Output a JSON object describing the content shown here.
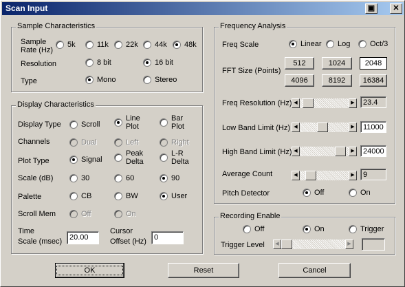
{
  "window": {
    "title": "Scan Input",
    "copy_icon": "▣",
    "close_icon": "✕"
  },
  "sample": {
    "group_label": "Sample Characteristics",
    "sample_rate": {
      "label1": "Sample",
      "label2": "Rate (Hz)",
      "options": [
        "5k",
        "11k",
        "22k",
        "44k",
        "48k"
      ],
      "selected": "48k"
    },
    "resolution": {
      "label": "Resolution",
      "options": [
        "8 bit",
        "16 bit"
      ],
      "selected": "16 bit"
    },
    "type": {
      "label": "Type",
      "options": [
        "Mono",
        "Stereo"
      ],
      "selected": "Mono"
    }
  },
  "display": {
    "group_label": "Display Characteristics",
    "display_type": {
      "label": "Display Type",
      "scroll": "Scroll",
      "line1": "Line",
      "line2": "Plot",
      "bar1": "Bar",
      "bar2": "Plot",
      "selected": "Line Plot"
    },
    "channels": {
      "label": "Channels",
      "options": [
        "Dual",
        "Left",
        "Right"
      ]
    },
    "plot_type": {
      "label": "Plot Type",
      "signal": "Signal",
      "peak1": "Peak",
      "peak2": "Delta",
      "lr1": "L-R",
      "lr2": "Delta",
      "selected": "Signal"
    },
    "scale": {
      "label": "Scale (dB)",
      "options": [
        "30",
        "60",
        "90"
      ],
      "selected": "90"
    },
    "palette": {
      "label": "Palette",
      "options": [
        "CB",
        "BW",
        "User"
      ],
      "selected": "User"
    },
    "scroll_mem": {
      "label": "Scroll Mem",
      "options": [
        "Off",
        "On"
      ]
    },
    "time_scale": {
      "label1": "Time",
      "label2": "Scale (msec)",
      "value": "20.00"
    },
    "cursor_offset": {
      "label1": "Cursor",
      "label2": "Offset (Hz)",
      "value": "0"
    }
  },
  "frequency": {
    "group_label": "Frequency Analysis",
    "freq_scale": {
      "label": "Freq Scale",
      "options": [
        "Linear",
        "Log",
        "Oct/3"
      ],
      "selected": "Linear"
    },
    "fft_size": {
      "label": "FFT Size (Points)",
      "options": [
        "512",
        "1024",
        "2048",
        "4096",
        "8192",
        "16384"
      ],
      "selected": "2048"
    },
    "freq_resolution": {
      "label": "Freq Resolution (Hz)",
      "value": "23.4",
      "position": 0.08
    },
    "low_band": {
      "label": "Low Band Limit (Hz)",
      "value": "11000",
      "position": 0.45
    },
    "high_band": {
      "label": "High Band Limit (Hz)",
      "value": "24000",
      "position": 0.93
    },
    "average_count": {
      "label": "Average Count",
      "value": "9",
      "position": 0.15
    },
    "pitch_detector": {
      "label": "Pitch Detector",
      "options": [
        "Off",
        "On"
      ],
      "selected": "Off"
    }
  },
  "recording": {
    "group_label": "Recording Enable",
    "options": [
      "Off",
      "On",
      "Trigger"
    ],
    "selected": "On",
    "trigger_level": {
      "label": "Trigger Level",
      "value": "",
      "position": 0.0
    }
  },
  "buttons": {
    "ok": "OK",
    "reset": "Reset",
    "cancel": "Cancel"
  },
  "arrows": {
    "left": "◀",
    "right": "▶"
  }
}
